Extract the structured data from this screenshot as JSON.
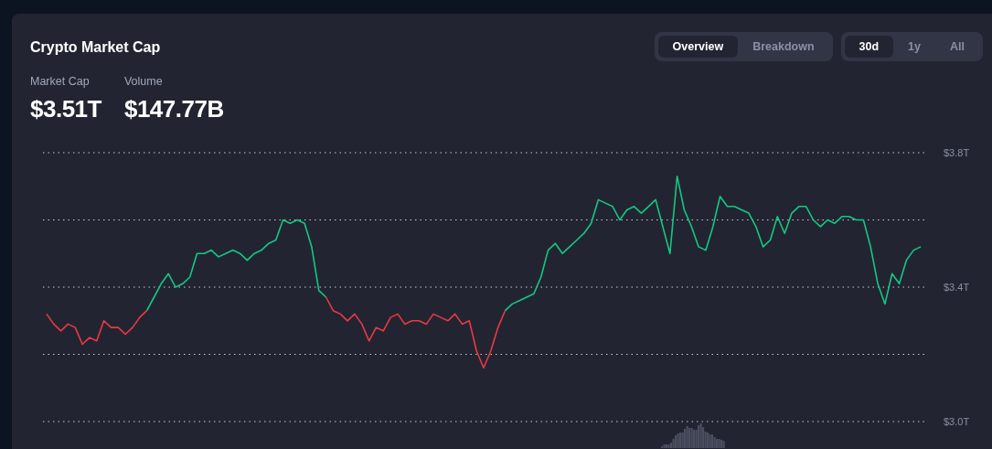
{
  "card": {
    "title": "Crypto Market Cap"
  },
  "view_tabs": [
    {
      "label": "Overview",
      "selected": true
    },
    {
      "label": "Breakdown",
      "selected": false
    }
  ],
  "range_tabs": [
    {
      "label": "30d",
      "selected": true
    },
    {
      "label": "1y",
      "selected": false
    },
    {
      "label": "All",
      "selected": false
    }
  ],
  "stats": [
    {
      "label": "Market Cap",
      "value": "$3.51T"
    },
    {
      "label": "Volume",
      "value": "$147.77B"
    }
  ],
  "chart_data": {
    "type": "line",
    "ylim": [
      3.0,
      3.8
    ],
    "yticks": [
      {
        "value": 3.0,
        "label": "$3.0T"
      },
      {
        "value": 3.4,
        "label": "$3.4T"
      },
      {
        "value": 3.8,
        "label": "$3.8T"
      }
    ],
    "series": [
      {
        "color": "#ea3943",
        "values": [
          3.32,
          3.29,
          3.27,
          3.29,
          3.28,
          3.23,
          3.25,
          3.24,
          3.3,
          3.28,
          3.28,
          3.26,
          3.28,
          3.31,
          3.33,
          null,
          null,
          null,
          null,
          null,
          null,
          null,
          null,
          null,
          null,
          null,
          null,
          null,
          null,
          null,
          null,
          null,
          null,
          null,
          null,
          null,
          null,
          null,
          null,
          3.37,
          3.33,
          3.32,
          3.3,
          3.32,
          3.29,
          3.24,
          3.28,
          3.27,
          3.31,
          3.32,
          3.29,
          3.3,
          3.3,
          3.29,
          3.32,
          3.31,
          3.3,
          3.32,
          3.29,
          3.3,
          3.21,
          3.16,
          3.21,
          3.28,
          3.33,
          null,
          null,
          null,
          null,
          null,
          null,
          null,
          null,
          null,
          null,
          null,
          null,
          null,
          null,
          null,
          null,
          null,
          null,
          null,
          null,
          null,
          null,
          null,
          null,
          null,
          null,
          null,
          null,
          null,
          null,
          null,
          null,
          null,
          null,
          null,
          null,
          null,
          null,
          null,
          null,
          null,
          null,
          null,
          null,
          null,
          null,
          null,
          null,
          null,
          null,
          null,
          null,
          null,
          null,
          null,
          null,
          null,
          null
        ]
      },
      {
        "color": "#16c784",
        "values": [
          null,
          null,
          null,
          null,
          null,
          null,
          null,
          null,
          null,
          null,
          null,
          null,
          null,
          null,
          3.33,
          3.37,
          3.41,
          3.44,
          3.4,
          3.41,
          3.43,
          3.5,
          3.5,
          3.51,
          3.49,
          3.5,
          3.51,
          3.5,
          3.48,
          3.5,
          3.51,
          3.53,
          3.54,
          3.6,
          3.59,
          3.6,
          3.59,
          3.52,
          3.39,
          3.37,
          null,
          null,
          null,
          null,
          null,
          null,
          null,
          null,
          null,
          null,
          null,
          null,
          null,
          null,
          null,
          null,
          null,
          null,
          null,
          null,
          null,
          null,
          null,
          null,
          3.33,
          3.35,
          3.36,
          3.37,
          3.38,
          3.43,
          3.51,
          3.53,
          3.5,
          3.52,
          3.54,
          3.56,
          3.59,
          3.66,
          3.65,
          3.64,
          3.6,
          3.63,
          3.64,
          3.62,
          3.64,
          3.66,
          3.58,
          3.5,
          3.73,
          3.63,
          3.58,
          3.52,
          3.51,
          3.58,
          3.67,
          3.64,
          3.64,
          3.63,
          3.62,
          3.58,
          3.52,
          3.54,
          3.61,
          3.56,
          3.62,
          3.64,
          3.64,
          3.6,
          3.58,
          3.6,
          3.59,
          3.61,
          3.61,
          3.6,
          3.6,
          3.52,
          3.41,
          3.35,
          3.44,
          3.41,
          3.48,
          3.51,
          3.52
        ]
      }
    ]
  }
}
